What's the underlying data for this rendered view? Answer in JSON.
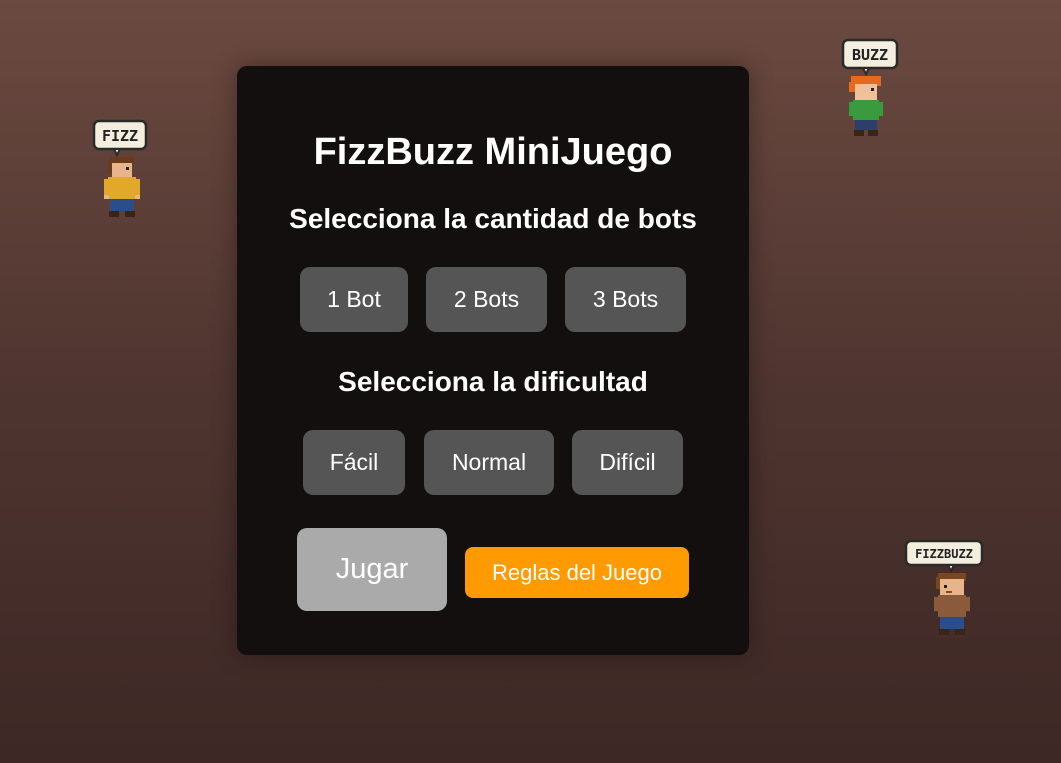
{
  "title": "FizzBuzz MiniJuego",
  "bots_heading": "Selecciona la cantidad de bots",
  "bot_options": [
    "1 Bot",
    "2 Bots",
    "3 Bots"
  ],
  "difficulty_heading": "Selecciona la dificultad",
  "difficulty_options": [
    "Fácil",
    "Normal",
    "Difícil"
  ],
  "play_label": "Jugar",
  "rules_label": "Reglas del Juego",
  "characters": [
    {
      "bubble": "FIZZ",
      "shirt": "yellow"
    },
    {
      "bubble": "BUZZ",
      "shirt": "green"
    },
    {
      "bubble": "FIZZBUZZ",
      "shirt": "brown"
    }
  ],
  "colors": {
    "panel": "#130f0e",
    "button": "#555555",
    "play_button": "#aaaaaa",
    "rules_button": "#ff9a00"
  }
}
